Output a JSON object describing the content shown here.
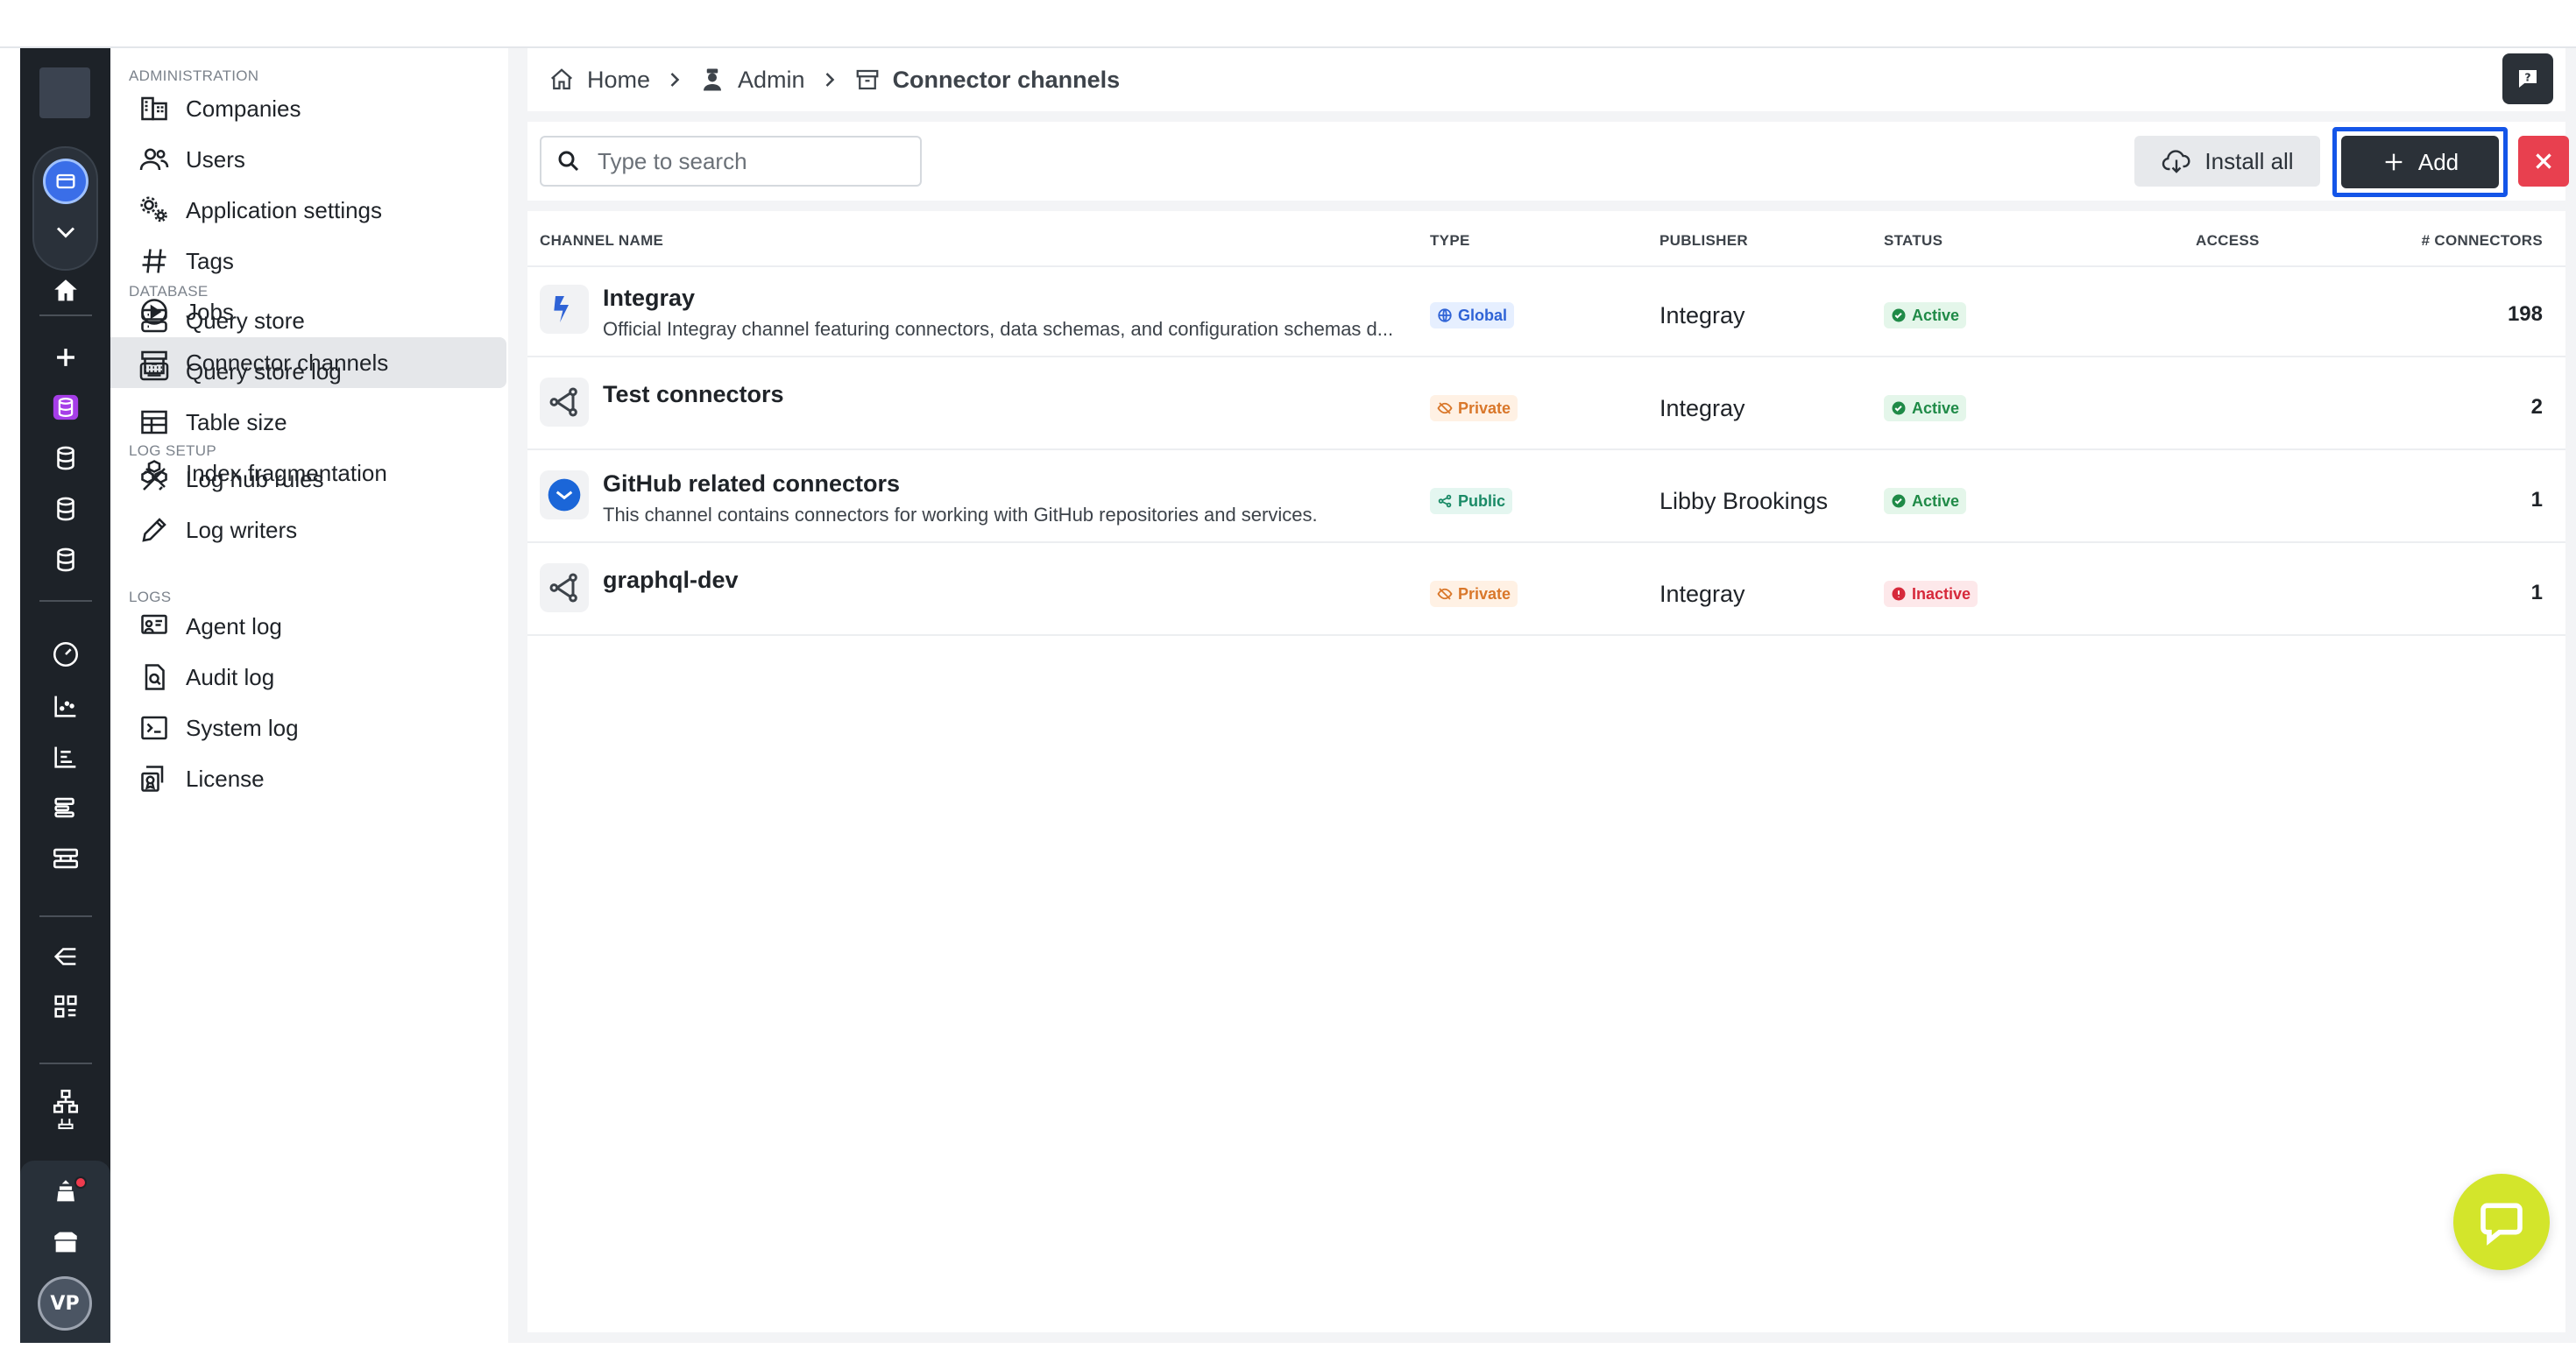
{
  "breadcrumb": [
    {
      "label": "Home",
      "icon": "home-icon"
    },
    {
      "label": "Admin",
      "icon": "admin-icon"
    },
    {
      "label": "Connector channels",
      "icon": "archive-icon"
    }
  ],
  "sidebar": {
    "sections": [
      {
        "title": "ADMINISTRATION",
        "items": [
          {
            "label": "Companies",
            "icon": "building-icon"
          },
          {
            "label": "Users",
            "icon": "users-icon"
          },
          {
            "label": "Application settings",
            "icon": "gears-icon"
          },
          {
            "label": "Tags",
            "icon": "hash-icon"
          },
          {
            "label": "Jobs",
            "icon": "play-circle-icon"
          },
          {
            "label": "Connector channels",
            "icon": "archive-icon",
            "active": true
          }
        ]
      },
      {
        "title": "DATABASE",
        "items": [
          {
            "label": "Query store",
            "icon": "server-icon"
          },
          {
            "label": "Query store log",
            "icon": "keyboard-icon"
          },
          {
            "label": "Table size",
            "icon": "table-icon"
          },
          {
            "label": "Index fragmentation",
            "icon": "cubes-icon"
          }
        ]
      },
      {
        "title": "LOG SETUP",
        "items": [
          {
            "label": "Log hub rules",
            "icon": "ruler-pencil-icon"
          },
          {
            "label": "Log writers",
            "icon": "pencil-icon"
          }
        ]
      },
      {
        "title": "LOGS",
        "items": [
          {
            "label": "Agent log",
            "icon": "agent-log-icon"
          },
          {
            "label": "Audit log",
            "icon": "audit-log-icon"
          },
          {
            "label": "System log",
            "icon": "terminal-icon"
          },
          {
            "label": "License",
            "icon": "license-icon"
          }
        ]
      }
    ]
  },
  "toolbar": {
    "search_placeholder": "Type to search",
    "install_all_label": "Install all",
    "add_label": "Add"
  },
  "table": {
    "headers": [
      "CHANNEL NAME",
      "TYPE",
      "PUBLISHER",
      "STATUS",
      "ACCESS",
      "# CONNECTORS"
    ],
    "rows": [
      {
        "name": "Integray",
        "description": "Official Integray channel featuring connectors, data schemas, and configuration schemas d...",
        "type": "Global",
        "publisher": "Integray",
        "status": "Active",
        "connectors": "198"
      },
      {
        "name": "Test connectors",
        "description": "",
        "type": "Private",
        "publisher": "Integray",
        "status": "Active",
        "connectors": "2"
      },
      {
        "name": "GitHub related connectors",
        "description": "This channel contains connectors for working with GitHub repositories and services.",
        "type": "Public",
        "publisher": "Libby Brookings",
        "status": "Active",
        "connectors": "1"
      },
      {
        "name": "graphql-dev",
        "description": "",
        "type": "Private",
        "publisher": "Integray",
        "status": "Inactive",
        "connectors": "1"
      }
    ]
  },
  "user": {
    "initials": "VP"
  },
  "colors": {
    "accent": "#1455e8",
    "dark": "#2b3138",
    "danger": "#e8404f",
    "chat": "#d3e52b"
  }
}
